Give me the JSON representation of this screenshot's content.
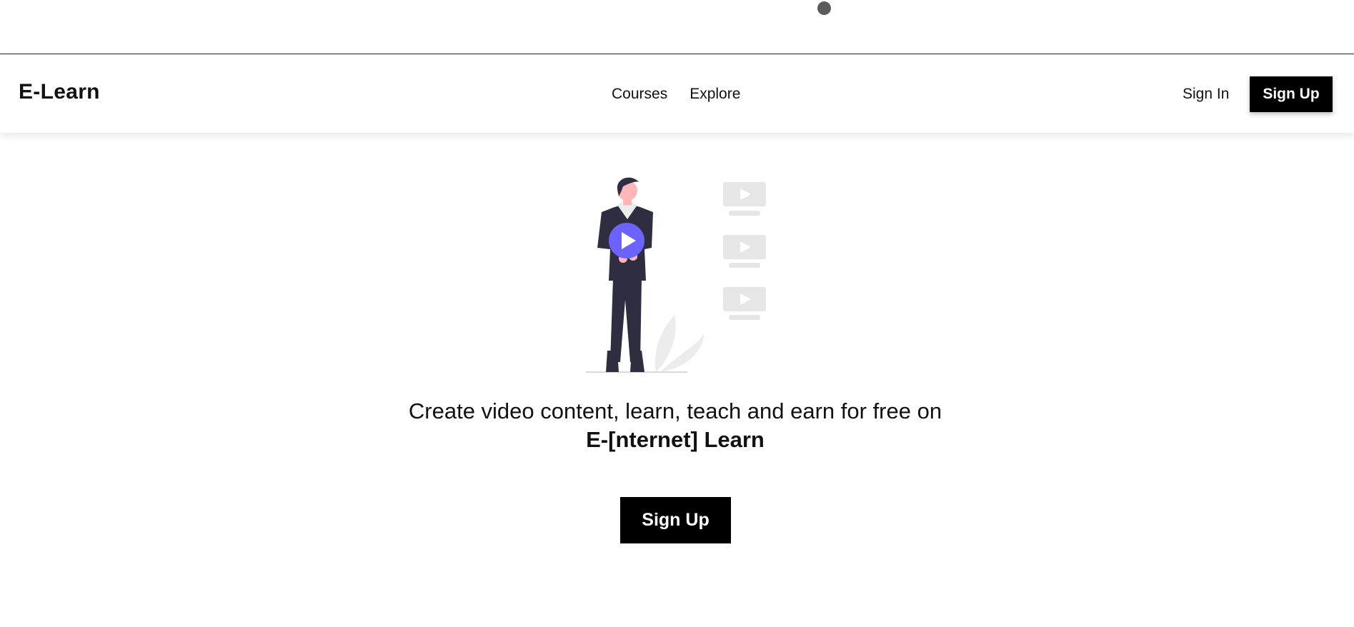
{
  "brand": {
    "title": "E-Learn"
  },
  "nav": {
    "links": [
      {
        "label": "Courses"
      },
      {
        "label": "Explore"
      }
    ]
  },
  "auth": {
    "signin_label": "Sign In",
    "signup_label": "Sign Up"
  },
  "hero": {
    "text_prefix": "Create video content, learn, teach and earn for free on ",
    "text_emphasis": "E-[nternet] Learn",
    "cta_label": "Sign Up"
  },
  "icons": [
    "person-with-play-button-illustration",
    "play-icon",
    "video-thumbnail-icon",
    "plant-icon"
  ],
  "colors": {
    "accent": "#6c63ff",
    "button_bg": "#000000",
    "button_text": "#ffffff",
    "figure": "#2f2e41"
  }
}
